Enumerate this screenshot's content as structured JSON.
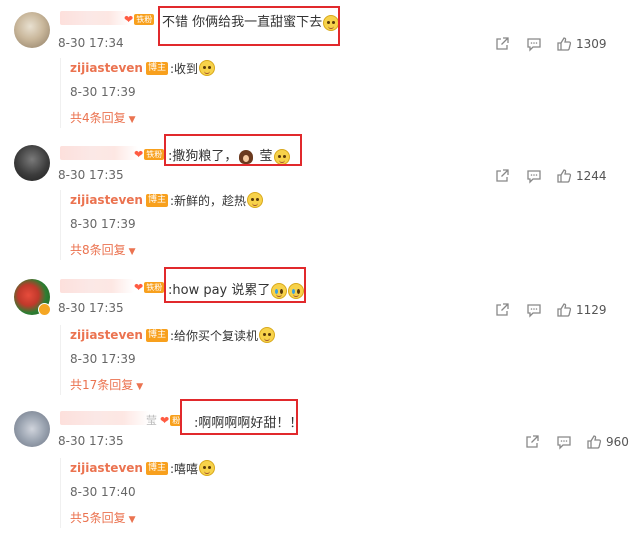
{
  "comments": [
    {
      "text": "不错 你俩给我一直甜蜜下去",
      "time": "8-30 17:34",
      "likes": "1309",
      "reply": {
        "author": "zijiasteven",
        "badge": "博主",
        "text": ":收到",
        "time": "8-30 17:39"
      },
      "more": "共4条回复"
    },
    {
      "text_before": ":撒狗粮了，",
      "text_after": " 莹",
      "time": "8-30 17:35",
      "likes": "1244",
      "reply": {
        "author": "zijiasteven",
        "badge": "博主",
        "text": ":新鲜的，趁热",
        "time": "8-30 17:39"
      },
      "more": "共8条回复"
    },
    {
      "text": ":how pay 说累了",
      "time": "8-30 17:35",
      "likes": "1129",
      "reply": {
        "author": "zijiasteven",
        "badge": "博主",
        "text": ":给你买个复读机",
        "time": "8-30 17:39"
      },
      "more": "共17条回复"
    },
    {
      "text": ":啊啊啊啊好甜！！",
      "time": "8-30 17:35",
      "likes": "960",
      "reply": {
        "author": "zijiasteven",
        "badge": "博主",
        "text": ":嘻嘻",
        "time": "8-30 17:40"
      },
      "more": "共5条回复"
    }
  ],
  "fan_badge": "铁粉",
  "fan_badge_short": "粉",
  "name_fragment": "莹",
  "icons": [
    "share-icon",
    "comment-icon",
    "like-icon",
    "caret-down-icon",
    "emoji-icon"
  ],
  "colors": {
    "author": "#eb7350",
    "badge": "#f8a01d",
    "highlight": "#e1292c"
  }
}
